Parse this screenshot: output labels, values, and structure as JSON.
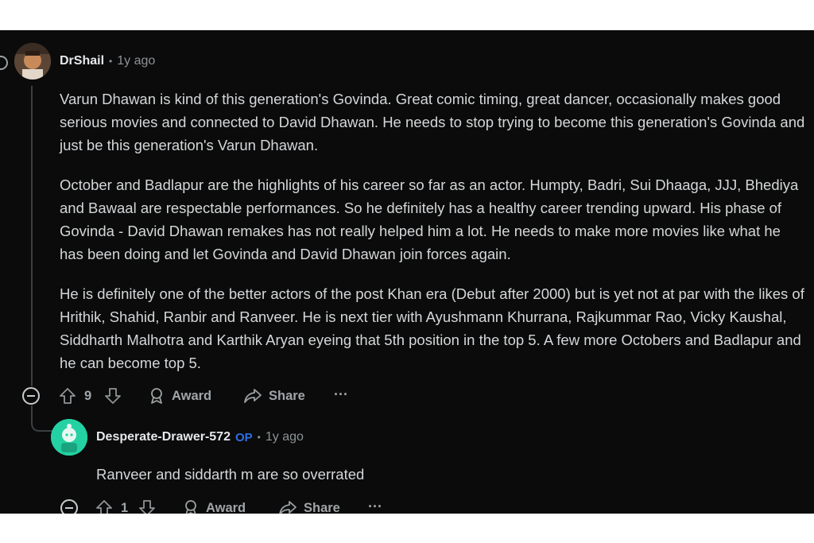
{
  "comment": {
    "username": "DrShail",
    "separator": "•",
    "timestamp": "1y ago",
    "paragraphs": [
      "Varun Dhawan is kind of this generation's Govinda. Great comic timing, great dancer, occasionally makes good serious movies and connected to David Dhawan. He needs to stop trying to become this generation's Govinda and just be this generation's Varun Dhawan.",
      "October and Badlapur are the highlights of his career so far as an actor. Humpty, Badri, Sui Dhaaga, JJJ, Bhediya and Bawaal are respectable performances. So he definitely has a healthy career trending upward. His phase of Govinda - David Dhawan remakes has not really helped him a lot. He needs to make more movies like what he has been doing and let Govinda and David Dhawan join forces again.",
      "He is definitely one of the better actors of the post Khan era (Debut after 2000) but is yet not at par with the likes of Hrithik, Shahid, Ranbir and Ranveer. He is next tier with Ayushmann Khurrana, Rajkummar Rao, Vicky Kaushal, Siddharth Malhotra and Karthik Aryan eyeing that 5th position in the top 5. A few more Octobers and Badlapur and he can become top 5."
    ],
    "votes": "9",
    "award_label": "Award",
    "share_label": "Share",
    "more_label": "···"
  },
  "reply": {
    "username": "Desperate-Drawer-572",
    "op_badge": "OP",
    "separator": "•",
    "timestamp": "1y ago",
    "text": "Ranveer and siddarth m are so overrated",
    "votes": "1",
    "award_label": "Award",
    "share_label": "Share",
    "more_label": "···"
  },
  "colors": {
    "panel_bg": "#0b0b0b",
    "text": "#d4d7d9",
    "muted": "#8d9396",
    "op_badge": "#2f6fe8",
    "reply_avatar_bg": "#24d1a2",
    "thread_line": "#3a3f42"
  }
}
